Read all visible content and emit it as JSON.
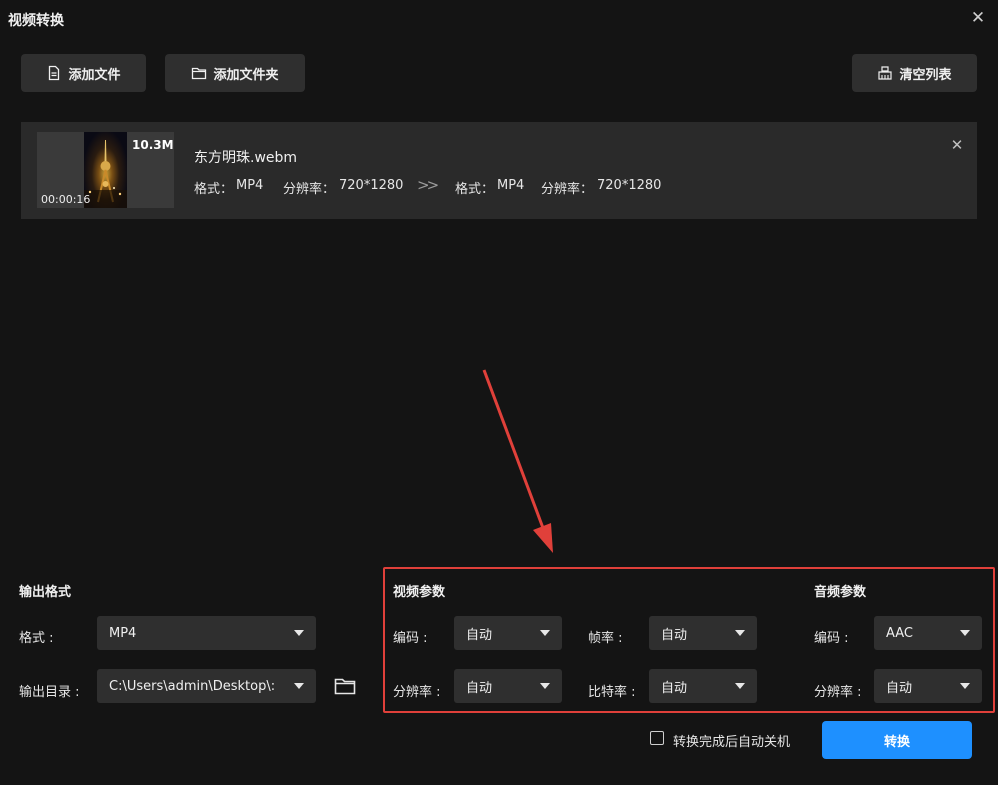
{
  "window": {
    "title": "视频转换",
    "close_icon": "close-icon"
  },
  "toolbar": {
    "add_file": "添加文件",
    "add_folder": "添加文件夹",
    "clear_list": "清空列表"
  },
  "file_list": [
    {
      "size": "10.3M",
      "duration": "00:00:16",
      "name": "东方明珠.webm",
      "source": {
        "format_label": "格式：",
        "format": "MP4",
        "resolution_label": "分辨率：",
        "resolution": "720*1280"
      },
      "target": {
        "format_label": "格式：",
        "format": "MP4",
        "resolution_label": "分辨率：",
        "resolution": "720*1280"
      }
    }
  ],
  "output": {
    "heading": "输出格式",
    "format_label": "格式 :",
    "format_value": "MP4",
    "dir_label": "输出目录 :",
    "dir_value": "C:\\Users\\admin\\Desktop\\:"
  },
  "video_params": {
    "heading": "视频参数",
    "codec_label": "编码 :",
    "codec_value": "自动",
    "framerate_label": "帧率 :",
    "framerate_value": "自动",
    "resolution_label": "分辨率 :",
    "resolution_value": "自动",
    "bitrate_label": "比特率 :",
    "bitrate_value": "自动"
  },
  "audio_params": {
    "heading": "音频参数",
    "codec_label": "编码 :",
    "codec_value": "AAC",
    "resolution_label": "分辨率 :",
    "resolution_value": "自动"
  },
  "footer": {
    "auto_shutdown_label": "转换完成后自动关机",
    "auto_shutdown_checked": false,
    "convert_button": "转换"
  },
  "colors": {
    "background": "#141414",
    "accent": "#1e90ff",
    "annotation": "#e0403a"
  }
}
